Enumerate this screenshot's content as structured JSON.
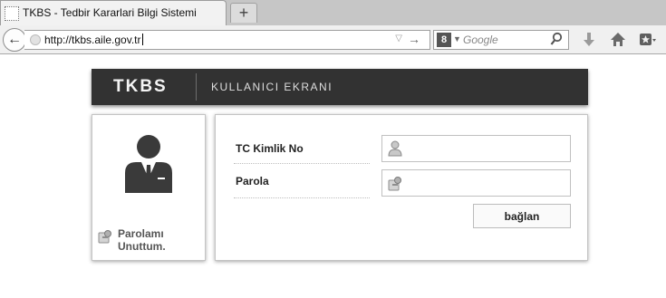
{
  "browser": {
    "tab_title": "TKBS - Tedbir Kararlari Bilgi Sistemi",
    "new_tab_label": "+",
    "url": "http://tkbs.aile.gov.tr",
    "search_placeholder": "Google",
    "search_engine_letter": "8"
  },
  "header": {
    "brand": "TKBS",
    "screen_title": "KULLANICI EKRANI",
    "background": "#323232"
  },
  "user_panel": {
    "avatar_icon": "user-suit-icon",
    "forgot_password_line1": "Parolamı",
    "forgot_password_line2": "Unuttum."
  },
  "login_form": {
    "tc_label": "TC Kimlik No",
    "tc_value": "",
    "tc_icon": "person-icon",
    "password_label": "Parola",
    "password_value": "",
    "password_icon": "key-icon",
    "connect_label": "bağlan"
  }
}
